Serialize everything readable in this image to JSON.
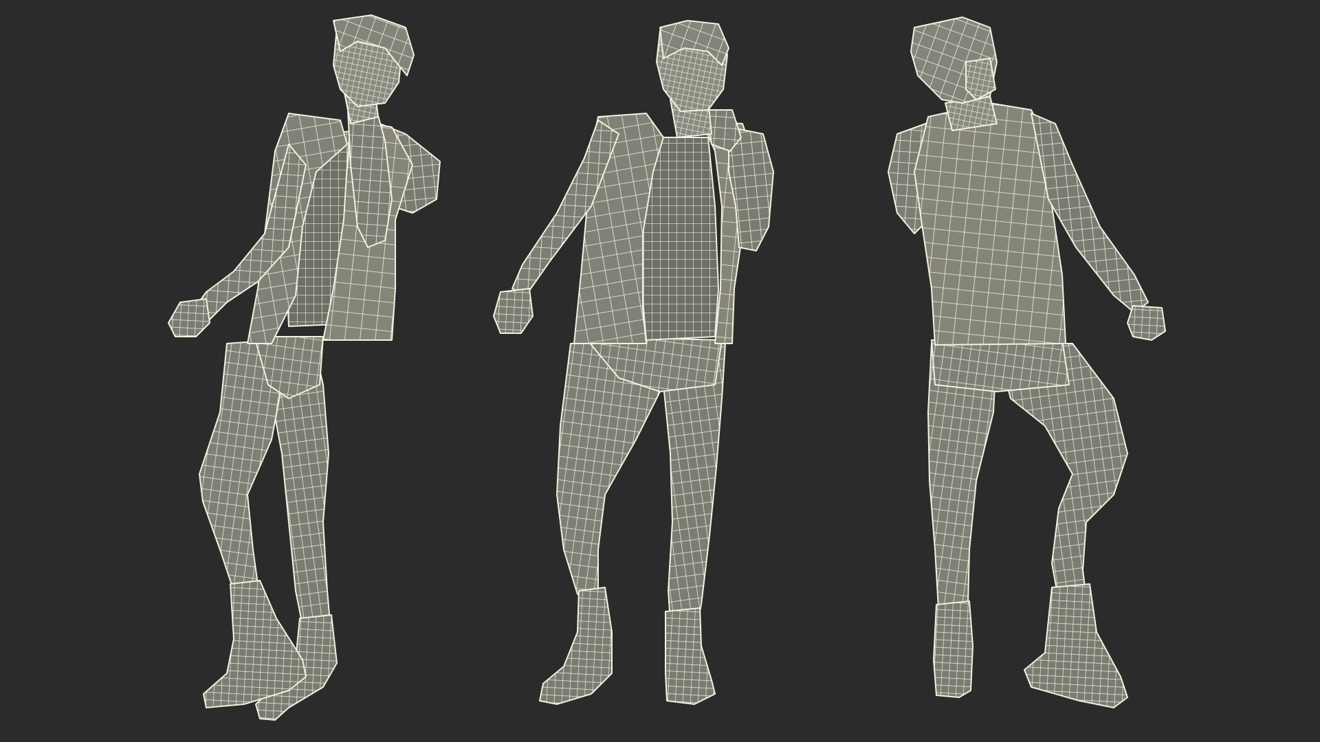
{
  "scene": {
    "background_color": "#2b2b2b",
    "mesh_fill_color": "#7c7d73",
    "mesh_shade_color": "#65665e",
    "wireframe_color": "#f3f1e0",
    "views": [
      {
        "id": "three-quarter-left",
        "facing": "front",
        "mirror": false
      },
      {
        "id": "front",
        "facing": "front",
        "mirror": false
      },
      {
        "id": "back",
        "facing": "back",
        "mirror": false
      }
    ]
  }
}
